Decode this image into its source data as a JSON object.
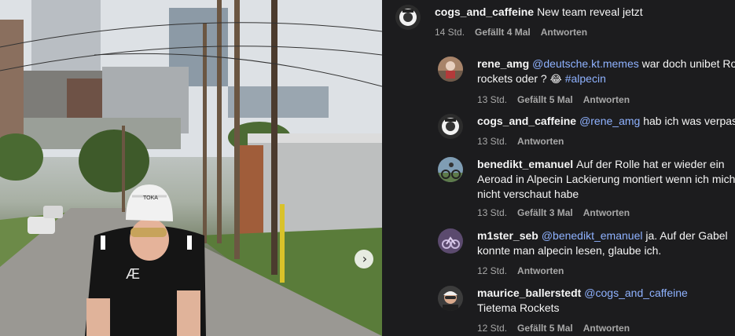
{
  "photo": {
    "carousel_next_glyph": "›",
    "helmet_brand": "TOKA",
    "jersey_mark": "Æ"
  },
  "comments": [
    {
      "username": "cogs_and_caffeine",
      "avatar": "bike-crank-avatar",
      "parts": [
        {
          "type": "text",
          "value": "New team reveal jetzt"
        }
      ],
      "time": "14 Std.",
      "likes": "Gefällt 4 Mal",
      "reply": "Antworten"
    },
    {
      "username": "rene_amg",
      "avatar": "cyclist-avatar",
      "parts": [
        {
          "type": "mention",
          "value": "@deutsche.kt.memes"
        },
        {
          "type": "text",
          "value": " war doch unibet Ros"
        },
        {
          "type": "text",
          "value": " rockets oder ? "
        },
        {
          "type": "emoji",
          "value": "😂"
        },
        {
          "type": "text",
          "value": " "
        },
        {
          "type": "hashtag",
          "value": "#alpecin"
        }
      ],
      "time": "13 Std.",
      "likes": "Gefällt 5 Mal",
      "reply": "Antworten"
    },
    {
      "username": "cogs_and_caffeine",
      "avatar": "bike-crank-avatar",
      "parts": [
        {
          "type": "mention",
          "value": "@rene_amg"
        },
        {
          "type": "text",
          "value": " hab ich was verpasst?"
        }
      ],
      "time": "13 Std.",
      "likes": "",
      "reply": "Antworten"
    },
    {
      "username": "benedikt_emanuel",
      "avatar": "mountain-bike-avatar",
      "parts": [
        {
          "type": "text",
          "value": "Auf der Rolle hat er wieder ein Aeroad in Alpecin Lackierung montiert wenn ich mich nicht verschaut habe"
        }
      ],
      "time": "13 Std.",
      "likes": "Gefällt 3 Mal",
      "reply": "Antworten"
    },
    {
      "username": "m1ster_seb",
      "avatar": "purple-bike-avatar",
      "parts": [
        {
          "type": "mention",
          "value": "@benedikt_emanuel"
        },
        {
          "type": "text",
          "value": " ja. Auf der Gabel konnte man alpecin lesen, glaube ich."
        }
      ],
      "time": "12 Std.",
      "likes": "",
      "reply": "Antworten"
    },
    {
      "username": "maurice_ballerstedt",
      "avatar": "rider-portrait-avatar",
      "parts": [
        {
          "type": "mention",
          "value": "@cogs_and_caffeine"
        },
        {
          "type": "text",
          "value": " Tietema Rockets"
        }
      ],
      "time": "12 Std.",
      "likes": "Gefällt 5 Mal",
      "reply": "Antworten"
    }
  ]
}
